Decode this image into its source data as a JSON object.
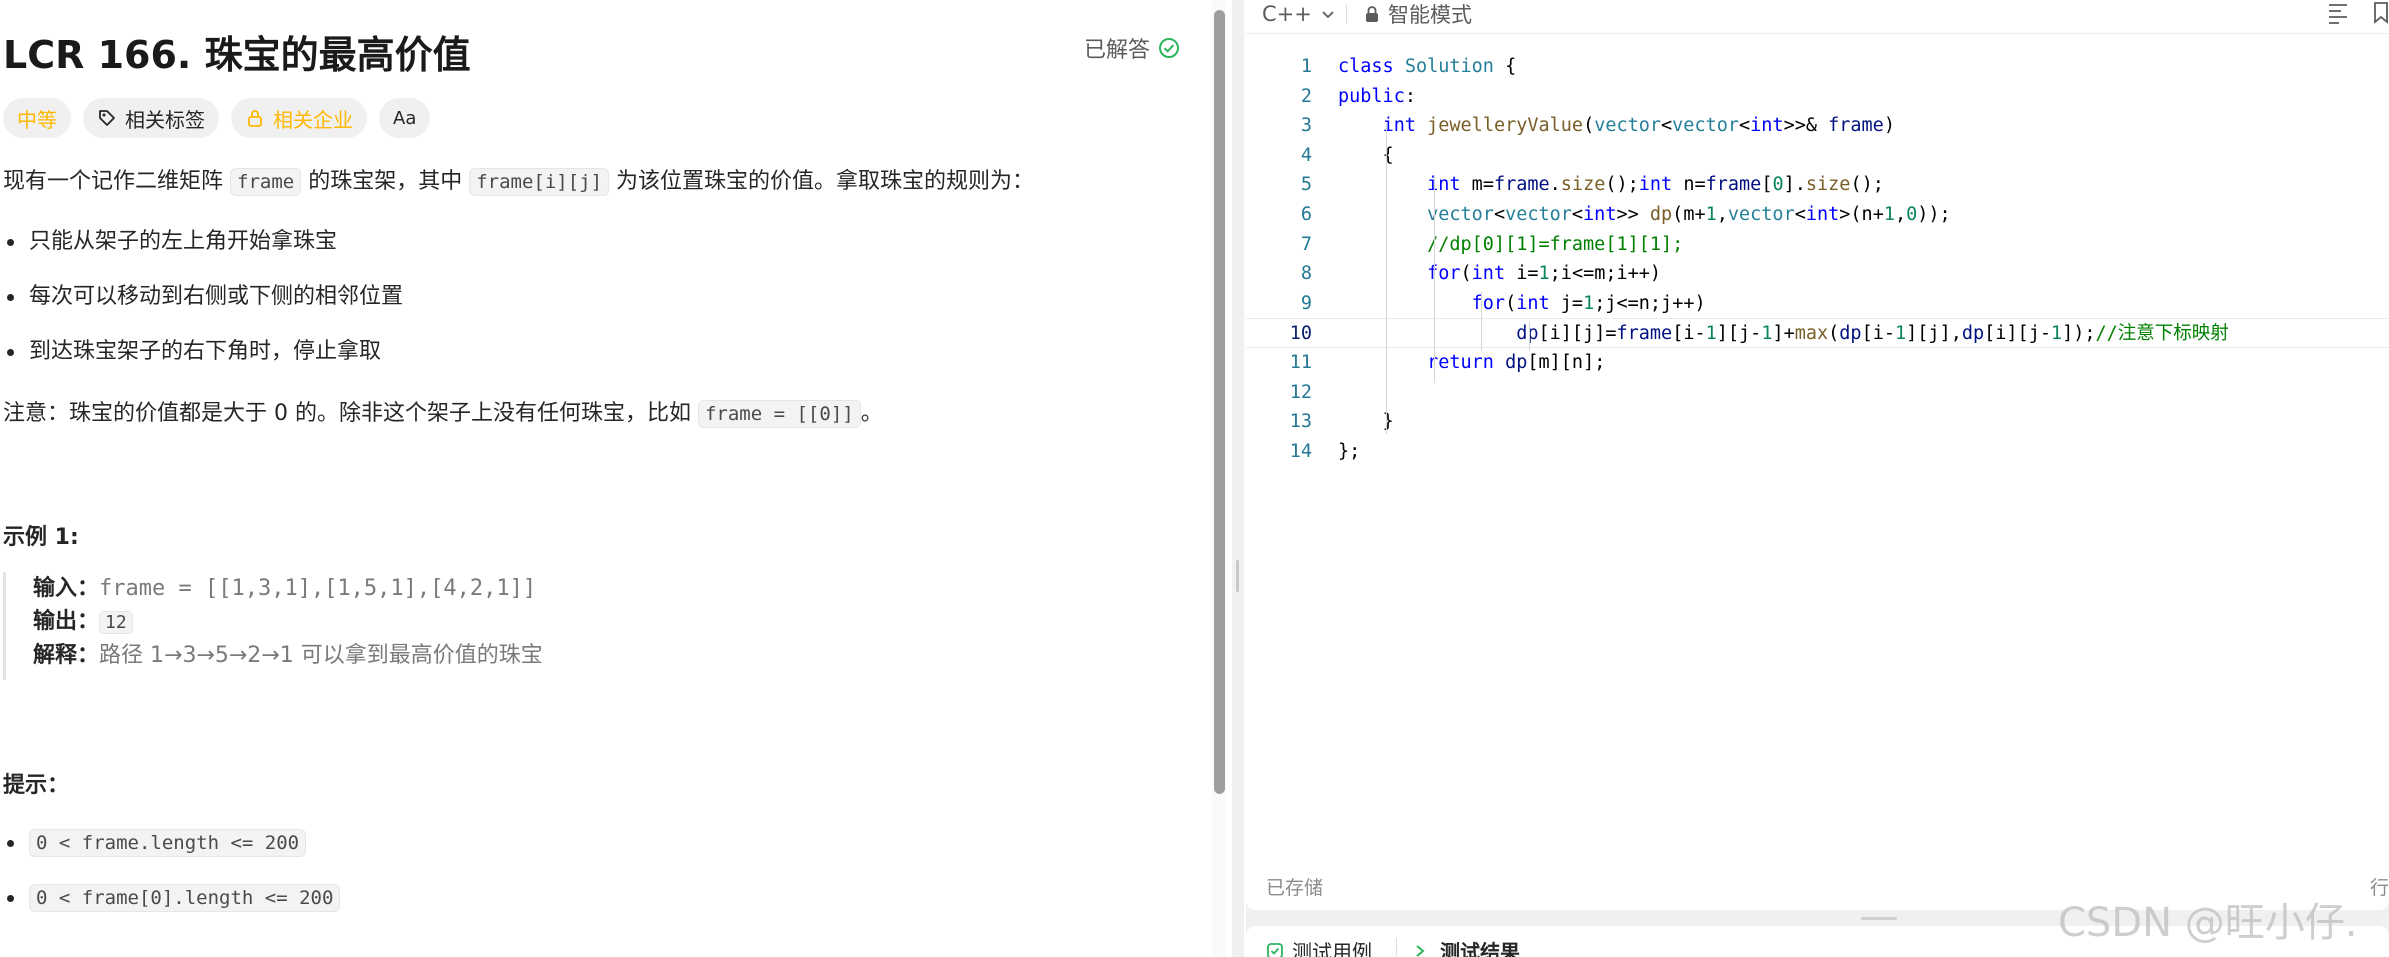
{
  "problem": {
    "title": "LCR 166. 珠宝的最高价值",
    "status": "已解答",
    "tags": {
      "difficulty": "中等",
      "related_tags": "相关标签",
      "related_companies": "相关企业",
      "translate": "Aa"
    },
    "desc_prefix": "现有一个记作二维矩阵 ",
    "desc_code1": "frame",
    "desc_mid": " 的珠宝架，其中 ",
    "desc_code2": "frame[i][j]",
    "desc_suffix": " 为该位置珠宝的价值。拿取珠宝的规则为：",
    "rules": [
      "只能从架子的左上角开始拿珠宝",
      "每次可以移动到右侧或下侧的相邻位置",
      "到达珠宝架子的右下角时，停止拿取"
    ],
    "note_prefix": "注意：珠宝的价值都是大于 0 的。除非这个架子上没有任何珠宝，比如 ",
    "note_code": "frame = [[0]]",
    "note_suffix": "。",
    "example_title": "示例 1:",
    "example": {
      "input_label": "输入：",
      "input_value": "frame = [[1,3,1],[1,5,1],[4,2,1]]",
      "output_label": "输出：",
      "output_value": "12",
      "explain_label": "解释：",
      "explain_value": "路径 1→3→5→2→1 可以拿到最高价值的珠宝"
    },
    "hints_title": "提示：",
    "hints": [
      "0 < frame.length <= 200",
      "0 < frame[0].length <= 200"
    ]
  },
  "editor": {
    "language": "C++",
    "mode": "智能模式",
    "saved_label": "已存储",
    "position_label": "行",
    "code_lines": [
      "class Solution {",
      "public:",
      "    int jewelleryValue(vector<vector<int>>& frame)",
      "    {",
      "        int m=frame.size();int n=frame[0].size();",
      "        vector<vector<int>> dp(m+1,vector<int>(n+1,0));",
      "        //dp[0][1]=frame[1][1];",
      "        for(int i=1;i<=m;i++)",
      "            for(int j=1;j<=n;j++)",
      "                dp[i][j]=frame[i-1][j-1]+max(dp[i-1][j],dp[i][j-1]);//注意下标映射",
      "        return dp[m][n];",
      "",
      "    }",
      "};"
    ],
    "active_line": 10
  },
  "bottom_panel": {
    "tab1": "测试用例",
    "tab2": "测试结果"
  },
  "watermark": "CSDN @旺小仔.",
  "colors": {
    "difficulty_medium": "#ffb800",
    "solved_green": "#2db55d",
    "keyword_blue": "#0000ff",
    "type_teal": "#267f99",
    "function_yellow": "#795e26",
    "number_green": "#098658",
    "comment_green": "#008000",
    "variable_navy": "#001080",
    "member_purple": "#af00db"
  }
}
